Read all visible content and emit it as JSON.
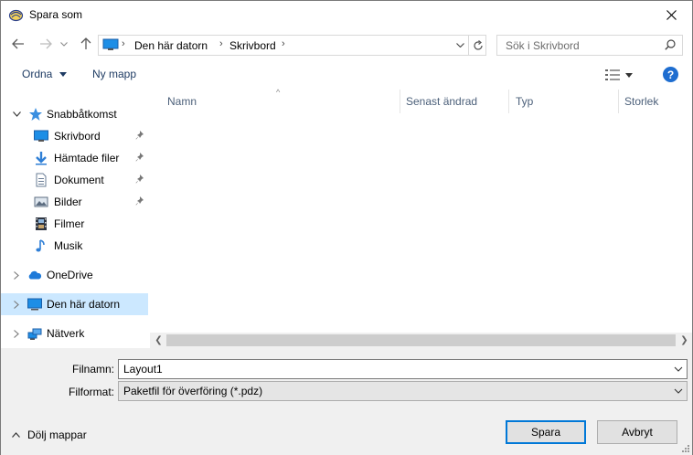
{
  "window": {
    "title": "Spara som"
  },
  "address": {
    "crumbs": [
      "Den här datorn",
      "Skrivbord"
    ],
    "search_placeholder": "Sök i Skrivbord"
  },
  "toolbar": {
    "organize": "Ordna",
    "new_folder": "Ny mapp",
    "help": "?"
  },
  "nav": {
    "quick_access": "Snabbåtkomst",
    "items": [
      "Skrivbord",
      "Hämtade filer",
      "Dokument",
      "Bilder",
      "Filmer",
      "Musik"
    ],
    "onedrive": "OneDrive",
    "this_pc": "Den här datorn",
    "network": "Nätverk"
  },
  "columns": {
    "name": "Namn",
    "modified": "Senast ändrad",
    "type": "Typ",
    "size": "Storlek"
  },
  "form": {
    "filename_label": "Filnamn:",
    "filename_value": "Layout1",
    "format_label": "Filformat:",
    "format_value": "Paketfil för överföring (*.pdz)"
  },
  "footer": {
    "hide_folders": "Dölj mappar",
    "save": "Spara",
    "cancel": "Avbryt"
  },
  "colors": {
    "accent": "#0078d7",
    "selected": "#cce8ff",
    "panel": "#f0f0f0"
  }
}
